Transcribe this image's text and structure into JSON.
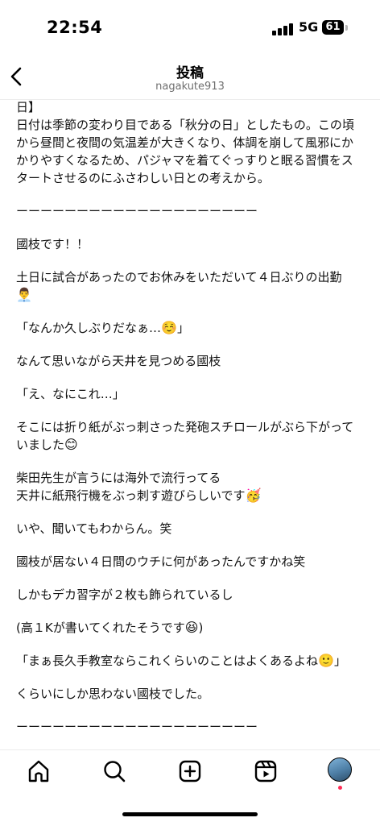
{
  "status": {
    "time": "22:54",
    "network": "5G",
    "battery": "61"
  },
  "header": {
    "title": "投稿",
    "username": "nagakute913"
  },
  "post": {
    "paragraphs": [
      {
        "text": "日】\n日付は季節の変わり目である「秋分の日」としたもの。この頃から昼間と夜間の気温差が大きくなり、体調を崩して風邪にかかりやすくなるため、パジャマを着てぐっすりと眠る習慣をスタートさせるのにふさわしい日との考えから。",
        "emoji": ""
      },
      {
        "text": "ーーーーーーーーーーーーーーーーーーーー",
        "emoji": ""
      },
      {
        "text": "國枝です！！",
        "emoji": ""
      },
      {
        "text": "土日に試合があったのでお休みをいただいて４日ぶりの出勤",
        "emoji": "👨‍💼"
      },
      {
        "text": "「なんか久しぶりだなぁ…",
        "emoji": "☺️",
        "suffix": "」"
      },
      {
        "text": "なんて思いながら天井を見つめる國枝",
        "emoji": ""
      },
      {
        "text": "「え、なにこれ…」",
        "emoji": ""
      },
      {
        "text": "そこには折り紙がぶっ刺さった発砲スチロールがぶら下がっていました",
        "emoji": "😊"
      },
      {
        "text": "柴田先生が言うには海外で流行ってる\n天井に紙飛行機をぶっ刺す遊びらしいです",
        "emoji": "🥳"
      },
      {
        "text": "いや、聞いてもわからん。笑",
        "emoji": ""
      },
      {
        "text": "國枝が居ない４日間のウチに何があったんですかね笑",
        "emoji": ""
      },
      {
        "text": "しかもデカ習字が２枚も飾られているし",
        "emoji": ""
      },
      {
        "text": "(高１Kが書いてくれたそうです",
        "emoji": "😆",
        "suffix": ")"
      },
      {
        "text": "「まぁ長久手教室ならこれくらいのことはよくあるよね",
        "emoji": "🙂",
        "suffix": "」"
      },
      {
        "text": "くらいにしか思わない國枝でした。",
        "emoji": ""
      },
      {
        "text": "ーーーーーーーーーーーーーーーーーーーー",
        "emoji": ""
      }
    ]
  },
  "tabbar": {
    "items": [
      {
        "name": "home-icon"
      },
      {
        "name": "search-icon"
      },
      {
        "name": "create-icon"
      },
      {
        "name": "reels-icon"
      },
      {
        "name": "profile-avatar"
      }
    ],
    "notification_color": "#ff2b55"
  }
}
